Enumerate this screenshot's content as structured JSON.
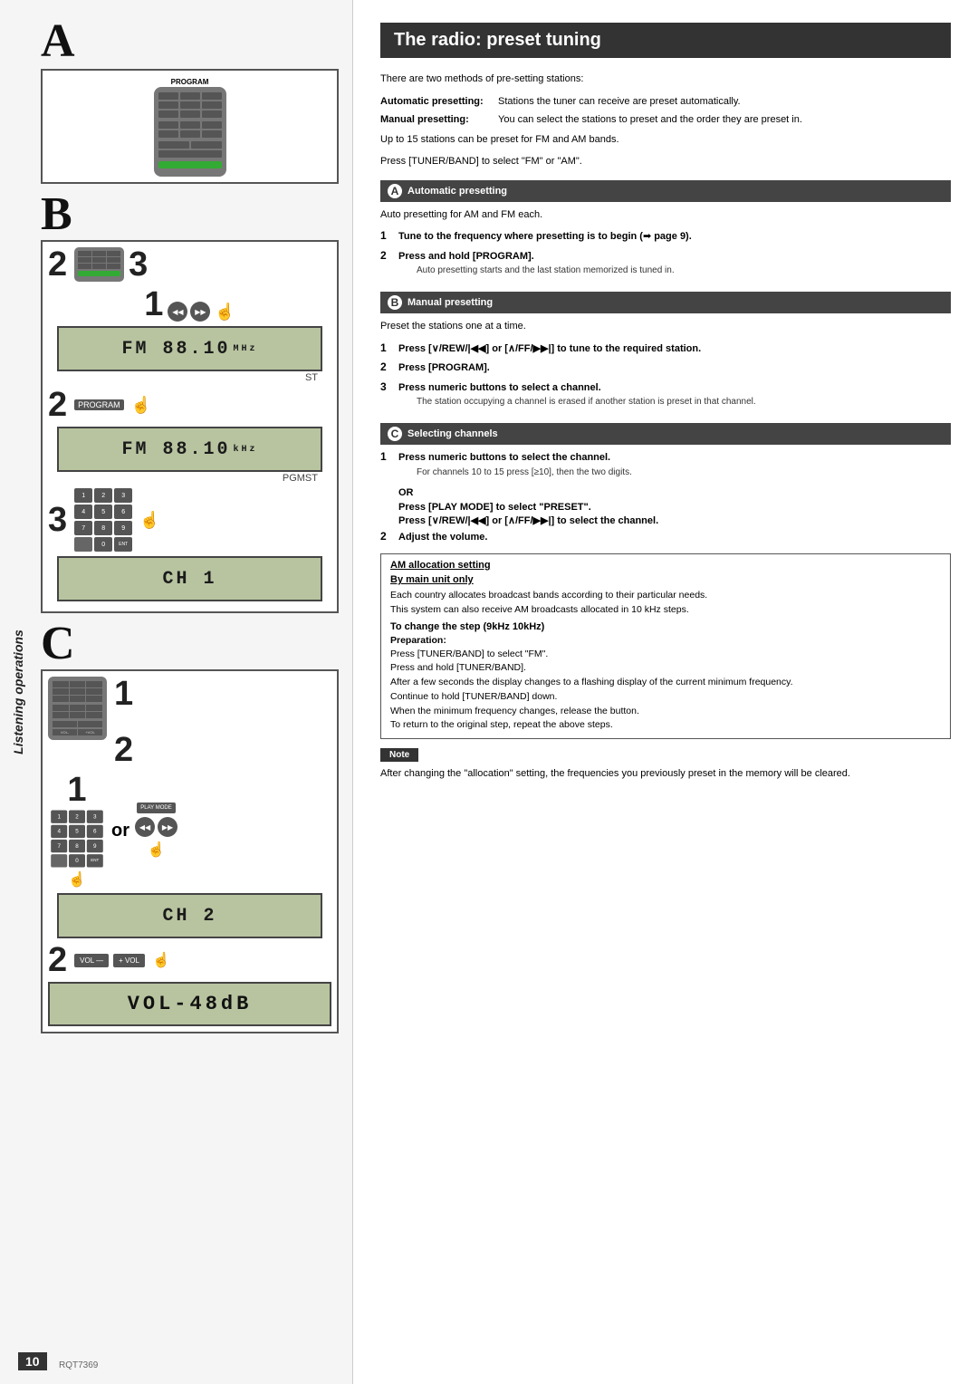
{
  "left_panel": {
    "side_label": "Listening operations",
    "page_number": "10",
    "model_number": "RQT7369",
    "section_a_label": "A",
    "section_b_label": "B",
    "section_c_label": "C",
    "step1": "1",
    "step2": "2",
    "step3": "3",
    "program_label": "PROGRAM",
    "display1": "FM  88.10",
    "display1_unit": "MHz",
    "display1_sub": "ST",
    "display2": "FM  88.10",
    "display2_unit": "kHz",
    "display2_sub": "PGMST",
    "display3": "CH  1",
    "display4": "CH  2",
    "display5": "VOL-48dB",
    "or_text": "or",
    "vol_label_minus": "VOL —",
    "vol_label_plus": "+ VOL",
    "play_mode_label": "PLAY MODE"
  },
  "right_panel": {
    "title": "The radio: preset tuning",
    "intro": {
      "line1": "There are two methods of pre-setting stations:",
      "auto_label": "Automatic presetting:",
      "auto_def": "Stations the tuner can receive are preset automatically.",
      "manual_label": "Manual presetting:",
      "manual_def": "You can select the stations to preset and the order they are preset in.",
      "note1": "Up to 15 stations can be preset for FM and AM bands.",
      "note2": "Press [TUNER/BAND] to select \"FM\" or \"AM\"."
    },
    "section_a": {
      "letter": "A",
      "title": "Automatic presetting",
      "intro": "Auto presetting for AM and FM each.",
      "step1_text": "Tune to the frequency where presetting is to begin (➡ page 9).",
      "step2_text": "Press and hold [PROGRAM].",
      "step2_sub": "Auto presetting starts and the last station memorized is tuned in."
    },
    "section_b": {
      "letter": "B",
      "title": "Manual presetting",
      "intro": "Preset the stations one at a time.",
      "step1_text": "Press [∨/REW/|◀◀] or [∧/FF/▶▶|] to tune to the required station.",
      "step2_text": "Press [PROGRAM].",
      "step3_text": "Press numeric buttons to select a channel.",
      "step3_sub": "The station occupying a channel is erased if another station is preset in that channel."
    },
    "section_c": {
      "letter": "C",
      "title": "Selecting channels",
      "step1_text": "Press numeric buttons to select the channel.",
      "step1_sub": "For channels 10 to 15 press [≥10], then the two digits.",
      "or_text": "OR",
      "play_mode_text": "Press [PLAY MODE] to select \"PRESET\".",
      "nav_text": "Press [∨/REW/|◀◀] or [∧/FF/▶▶|] to select the channel.",
      "step2_text": "Adjust the volume."
    },
    "am_section": {
      "title": "AM allocation setting",
      "by_main": "By main unit only",
      "para1": "Each country allocates broadcast bands according to their particular needs.",
      "para2": "This system can also receive AM broadcasts allocated in 10 kHz steps.",
      "change_title": "To change the step (9kHz    10kHz)",
      "prep_label": "Preparation:",
      "prep1": "Press [TUNER/BAND] to select \"FM\".",
      "prep2": "Press and hold [TUNER/BAND].",
      "prep3": "After a few seconds the display changes to a flashing display of the current minimum frequency.",
      "prep4": "Continue to hold [TUNER/BAND] down.",
      "prep5": "When the minimum frequency changes, release the button.",
      "prep6": "To return to the original step, repeat the above steps."
    },
    "note_section": {
      "note_label": "Note",
      "note_text": "After changing the \"allocation\" setting, the frequencies you previously preset in the memory will be cleared."
    }
  }
}
